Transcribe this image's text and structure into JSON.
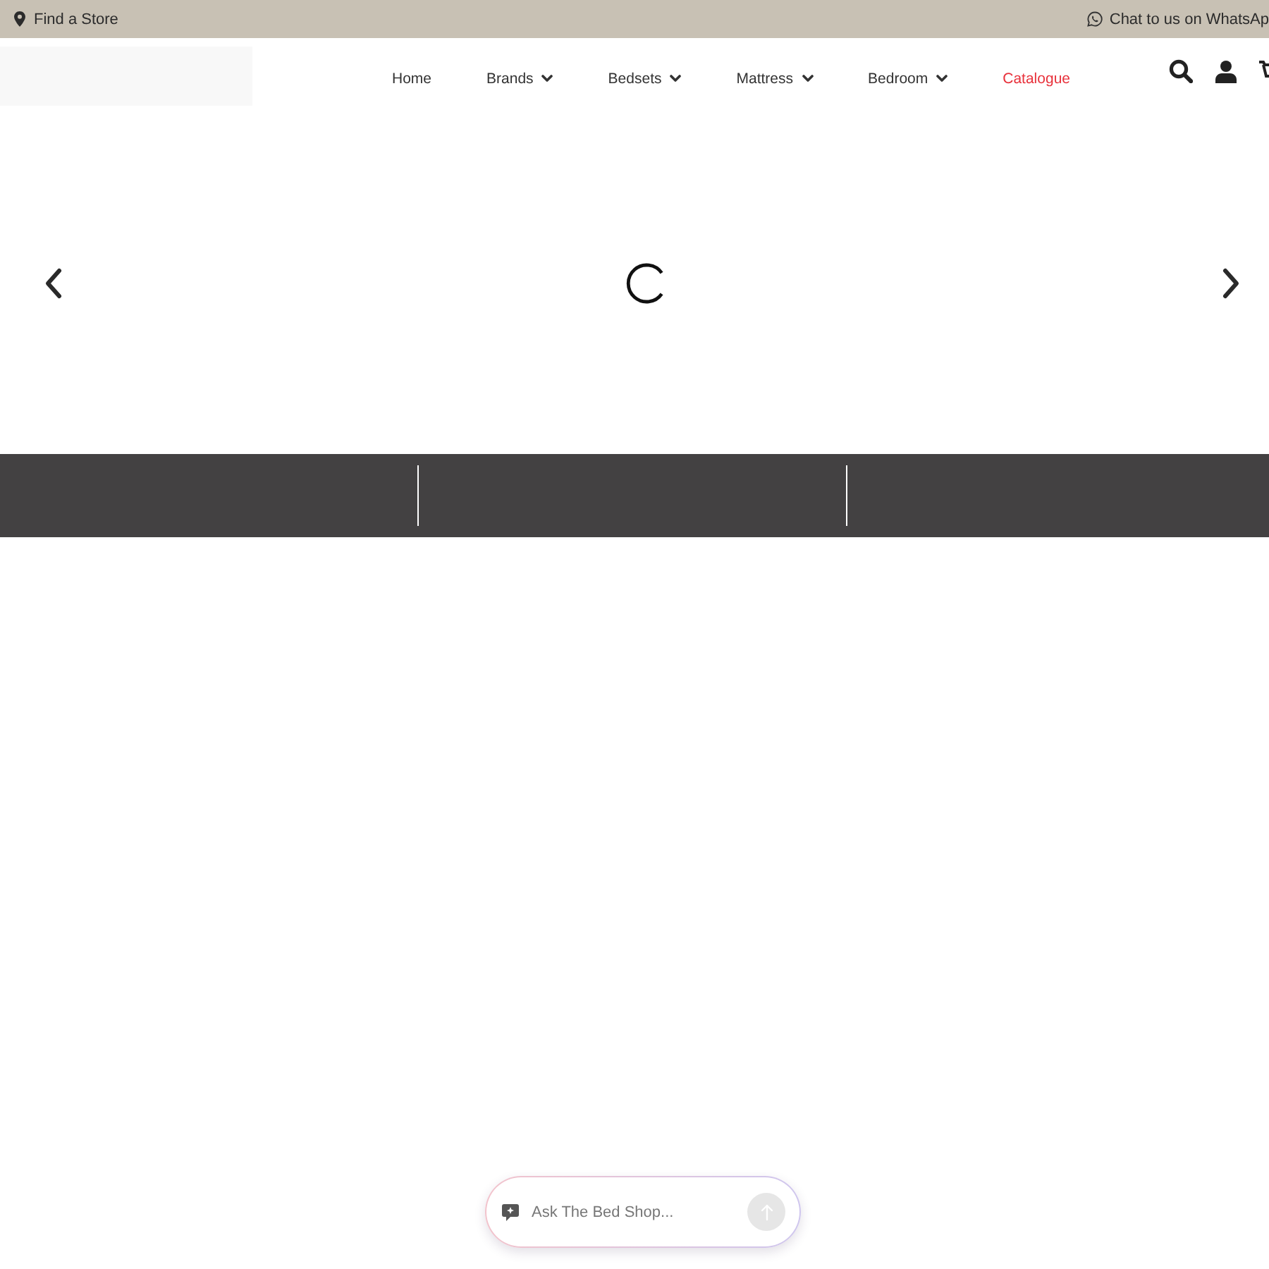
{
  "top_bar": {
    "store_link": {
      "label": "Find a Store"
    },
    "whatsapp_link": {
      "label": "Chat to us on WhatsAp"
    }
  },
  "header": {
    "nav": [
      {
        "label": "Home",
        "dropdown": false,
        "highlighted": false
      },
      {
        "label": "Brands",
        "dropdown": true,
        "highlighted": false
      },
      {
        "label": "Bedsets",
        "dropdown": true,
        "highlighted": false
      },
      {
        "label": "Mattress",
        "dropdown": true,
        "highlighted": false
      },
      {
        "label": "Bedroom",
        "dropdown": true,
        "highlighted": false
      },
      {
        "label": "Catalogue",
        "dropdown": false,
        "highlighted": true
      }
    ]
  },
  "hero": {
    "loading": true
  },
  "chat": {
    "placeholder": "Ask The Bed Shop...",
    "send_button": {
      "disabled": true
    }
  }
}
